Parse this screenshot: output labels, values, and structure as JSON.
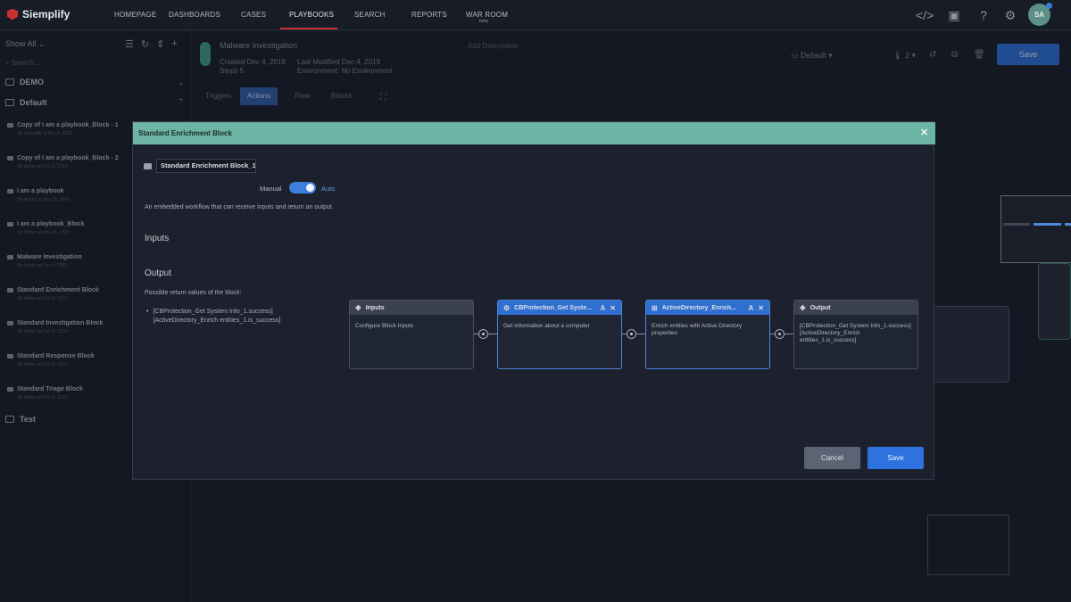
{
  "app": {
    "name": "Siemplify"
  },
  "nav": {
    "items": [
      "HOMEPAGE",
      "DASHBOARDS",
      "CASES",
      "PLAYBOOKS",
      "SEARCH",
      "REPORTS",
      "WAR ROOM"
    ],
    "war_room_sub": "beta",
    "active": "PLAYBOOKS",
    "avatar": "SA"
  },
  "sidebar": {
    "show_all": "Show All",
    "search_placeholder": "Search...",
    "folders": [
      "DEMO",
      "Default",
      "Test"
    ],
    "playbooks": [
      {
        "title": "Copy of I am a playbook_Block - 1",
        "sub": "By siemplify at Dec 5, 2019"
      },
      {
        "title": "Copy of I am a playbook_Block - 2",
        "sub": "By Admin at Dec 5, 2019"
      },
      {
        "title": "I am a playbook",
        "sub": "By Admin at Nov 21, 2019"
      },
      {
        "title": "I am a playbook_Block",
        "sub": "By Admin at Nov 21, 2019"
      },
      {
        "title": "Malware Investigation",
        "sub": "By Admin at Dec 4, 2019"
      },
      {
        "title": "Standard Enrichment Block",
        "sub": "By Admin at Dec 4, 2019"
      },
      {
        "title": "Standard Investigation Block",
        "sub": "By Admin at Dec 4, 2019"
      },
      {
        "title": "Standard Response Block",
        "sub": "By Admin at Dec 4, 2019"
      },
      {
        "title": "Standard Triage Block",
        "sub": "By Admin at Dec 4, 2019"
      }
    ]
  },
  "background": {
    "playbook_title": "Malware Investigation",
    "created": "Created Dec 4, 2019",
    "steps": "Steps 5",
    "modified": "Last Modified Dec 4, 2019",
    "environment": "Environment: No Environment",
    "add_description": "Add Description",
    "default": "Default",
    "priority": "2",
    "save": "Save",
    "tabs": [
      "Triggers",
      "Actions",
      "Flow",
      "Blocks"
    ]
  },
  "modal": {
    "title": "Standard Enrichment Block",
    "name_value": "Standard Enrichment Block_1",
    "manual_label": "Manual",
    "auto_label": "Auto",
    "description": "An embedded workflow that can receive inputs and return an output.",
    "inputs_heading": "Inputs",
    "output_heading": "Output",
    "output_sub": "Possible return values of the block:",
    "return_values": "[CBProtection_Get System Info_1.success] [ActiveDirectory_Enrich entities_1.is_success]",
    "cancel": "Cancel",
    "save": "Save",
    "nodes": [
      {
        "title": "Inputs",
        "body": "Configure Block Inputs",
        "selected": false
      },
      {
        "title": "CBProtection_Get System...",
        "body": "Get information about a computer",
        "selected": true
      },
      {
        "title": "ActiveDirectory_Enrich...",
        "body": "Enrich entities with Active Directory properties",
        "selected": true
      },
      {
        "title": "Output",
        "body": "[CBProtection_Get System Info_1.success] [ActiveDirectory_Enrich entities_1.is_success]",
        "selected": false
      }
    ]
  },
  "colors": {
    "accent": "#2e72df",
    "modal_header": "#6cb4a3",
    "brand_red": "#c8312f"
  }
}
